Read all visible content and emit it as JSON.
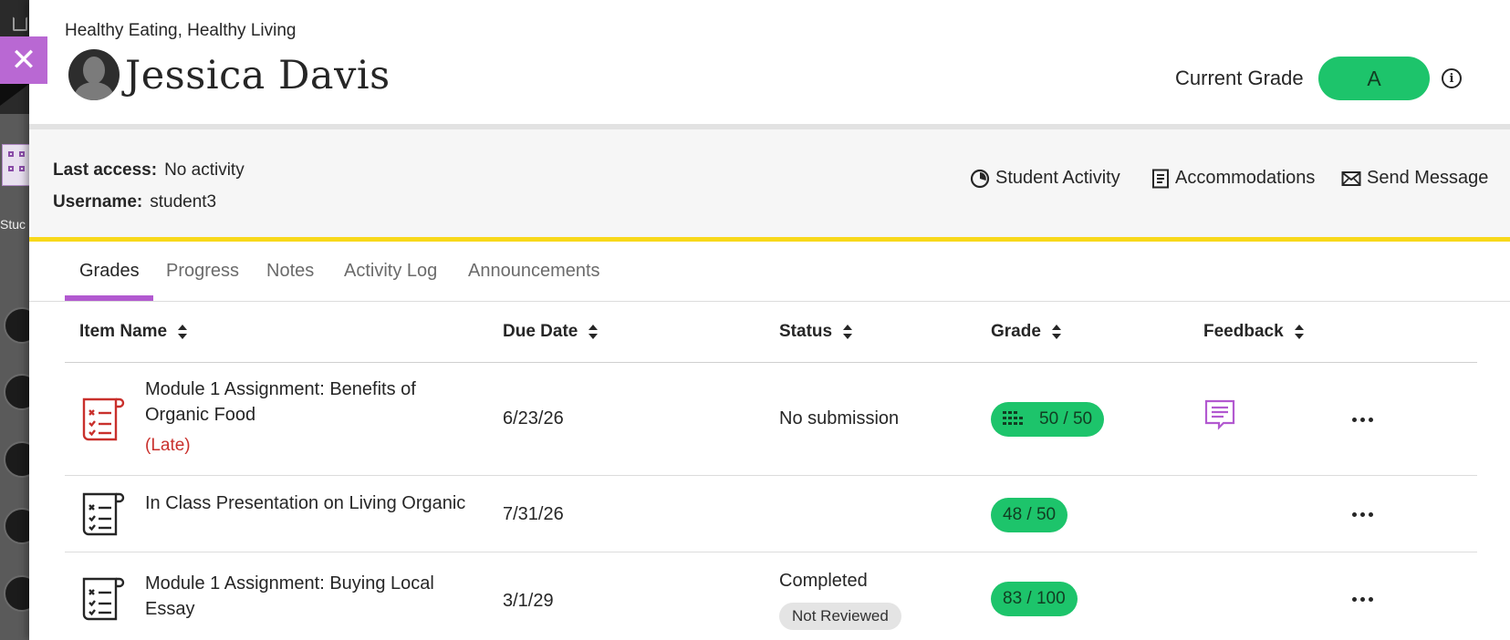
{
  "background": {
    "partial_label": "Stuc"
  },
  "header": {
    "course_name": "Healthy Eating, Healthy Living",
    "student_name": "Jessica Davis",
    "current_grade_label": "Current Grade",
    "current_grade": "A",
    "close_icon": "close-icon",
    "info_icon": "info-icon"
  },
  "info": {
    "last_access_label": "Last access:",
    "last_access_value": "No activity",
    "username_label": "Username:",
    "username_value": "student3"
  },
  "actions": [
    {
      "label": "Student Activity",
      "icon": "activity-icon"
    },
    {
      "label": "Accommodations",
      "icon": "accommodations-icon"
    },
    {
      "label": "Send Message",
      "icon": "mail-icon"
    }
  ],
  "tabs": [
    {
      "label": "Grades",
      "active": true
    },
    {
      "label": "Progress",
      "active": false
    },
    {
      "label": "Notes",
      "active": false
    },
    {
      "label": "Activity Log",
      "active": false
    },
    {
      "label": "Announcements",
      "active": false
    }
  ],
  "table": {
    "columns": [
      "Item Name",
      "Due Date",
      "Status",
      "Grade",
      "Feedback"
    ],
    "rows": [
      {
        "title": "Module 1 Assignment: Benefits of Organic Food",
        "late": "(Late)",
        "due": "6/23/26",
        "status": "No submission",
        "review": "",
        "grade": "50 / 50",
        "has_rubric_icon": true,
        "has_feedback": true,
        "icon_color": "#c9302c"
      },
      {
        "title": "In Class Presentation on Living Organic",
        "late": "",
        "due": "7/31/26",
        "status": "",
        "review": "",
        "grade": "48 / 50",
        "has_rubric_icon": false,
        "has_feedback": false,
        "icon_color": "#262626"
      },
      {
        "title": "Module 1 Assignment: Buying Local Essay",
        "late": "",
        "due": "3/1/29",
        "status": "Completed",
        "review": "Not Reviewed",
        "grade": "83 / 100",
        "has_rubric_icon": false,
        "has_feedback": false,
        "icon_color": "#262626"
      }
    ]
  },
  "colors": {
    "accent_purple": "#b259d0",
    "grade_green": "#1dc46b",
    "late_red": "#c9302c",
    "band_yellow": "#f8d81a"
  }
}
